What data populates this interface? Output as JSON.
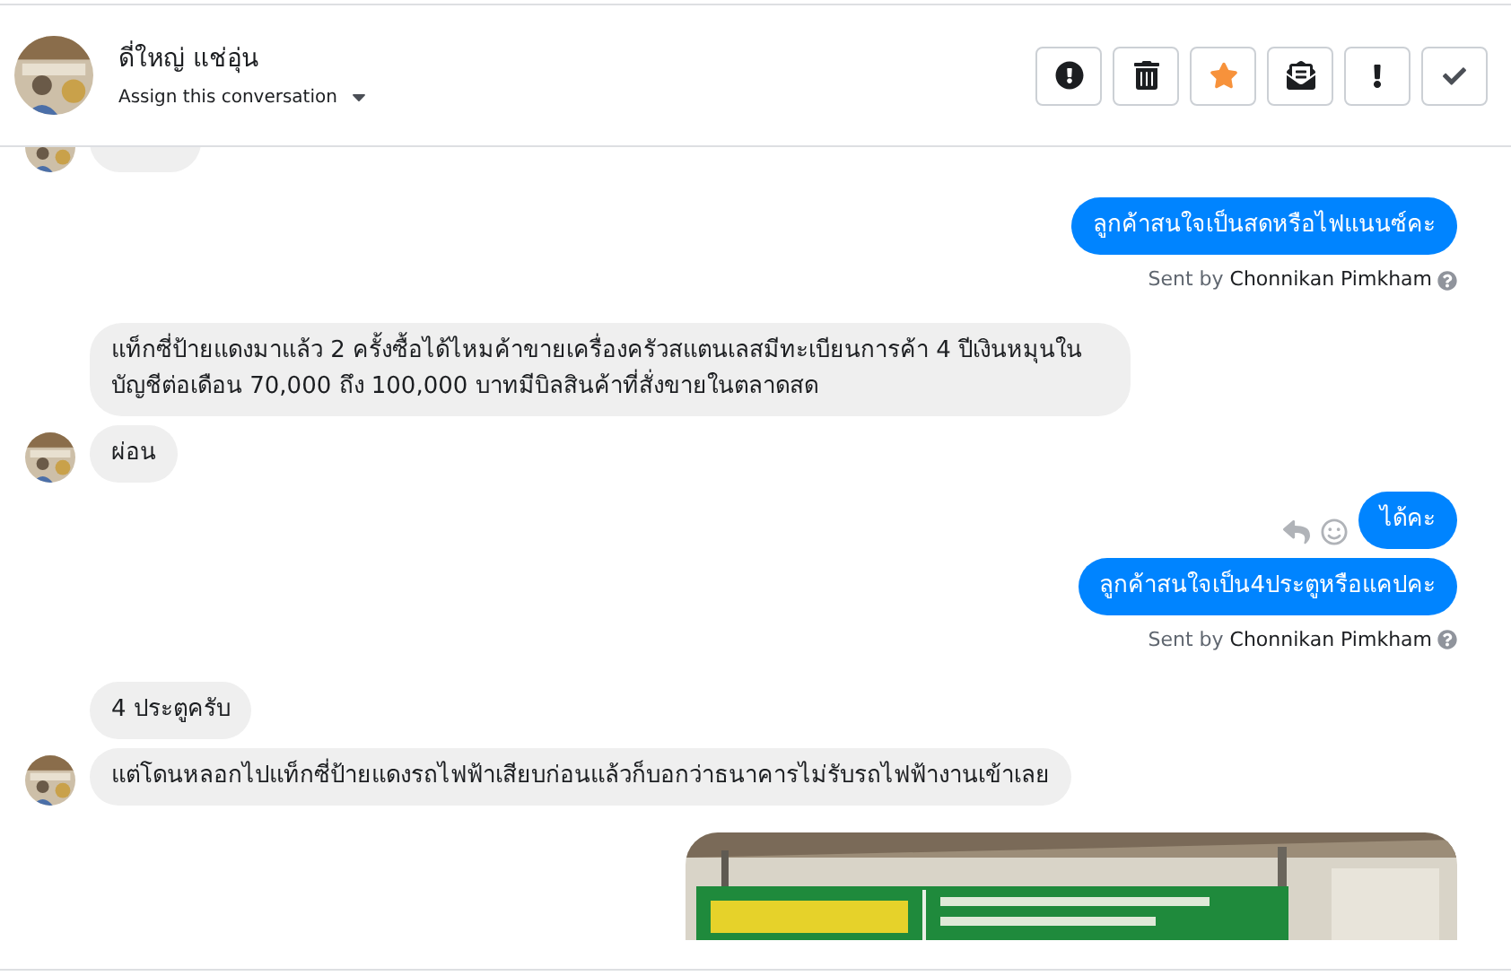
{
  "header": {
    "name": "ดี่ใหญ่ แช่อุ่น",
    "assign": "Assign this conversation",
    "buttons": [
      {
        "kind": "alert",
        "on": false
      },
      {
        "kind": "trash",
        "on": false
      },
      {
        "kind": "star",
        "on": true
      },
      {
        "kind": "envelope",
        "on": false
      },
      {
        "kind": "exclaim",
        "on": false
      },
      {
        "kind": "check",
        "on": false
      }
    ]
  },
  "messages": [
    {
      "kind": "cut",
      "avatar": true
    },
    {
      "kind": "outgoing",
      "text": "ลูกค้าสนใจเป็นสดหรือไฟแนนซ์คะ",
      "sent_by_label": "Sent by",
      "sent_by": "Chonnikan Pimkham"
    },
    {
      "kind": "incoming",
      "text": "แท็กซี่ป้ายแดงมาแล้ว 2 ครั้งซื้อได้ไหมค้าขายเครื่องครัวสแตนเลสมีทะเบียนการค้า 4 ปีเงินหมุนในบัญชีต่อเดือน 70,000 ถึง 100,000 บาทมีบิลสินค้าที่สั่งขายในตลาดสด",
      "avatar": false
    },
    {
      "kind": "incoming",
      "text": "ผ่อน",
      "avatar": true
    },
    {
      "kind": "outgoing",
      "text": "ได้คะ",
      "hover_actions": true
    },
    {
      "kind": "outgoing",
      "text": "ลูกค้าสนใจเป็น4ประตูหรือแคปคะ",
      "sent_by_label": "Sent by",
      "sent_by": "Chonnikan Pimkham"
    },
    {
      "kind": "incoming",
      "text": "4 ประตูครับ",
      "avatar": false
    },
    {
      "kind": "incoming",
      "text": "แต่โดนหลอกไปแท็กซี่ป้ายแดงรถไฟฟ้าเสียบก่อนแล้วก็บอกว่าธนาคารไม่รับรถไฟฟ้างานเข้าเลย",
      "avatar": true
    },
    {
      "kind": "picture"
    }
  ]
}
